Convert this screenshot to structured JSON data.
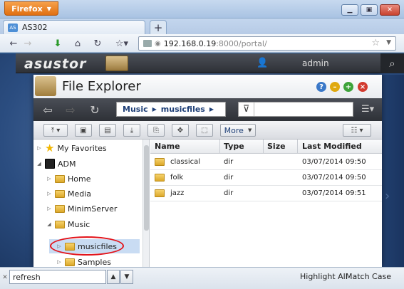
{
  "browser": {
    "app_button": "Firefox",
    "tab_title": "AS302",
    "url_host": "192.168.0.19",
    "url_rest": ":8000/portal/"
  },
  "asustor": {
    "logo": "asustor",
    "username": "admin"
  },
  "file_explorer": {
    "title": "File Explorer",
    "breadcrumb": [
      "Music",
      "musicfiles"
    ],
    "toolbar_more": "More",
    "tree": [
      {
        "label": "My Favorites"
      },
      {
        "label": "ADM"
      },
      {
        "label": "Home"
      },
      {
        "label": "Media"
      },
      {
        "label": "MinimServer"
      },
      {
        "label": "Music"
      },
      {
        "label": "musicfiles"
      },
      {
        "label": "Samples"
      }
    ],
    "columns": {
      "name": "Name",
      "type": "Type",
      "size": "Size",
      "modified": "Last Modified"
    },
    "rows": [
      {
        "name": "classical",
        "type": "dir",
        "size": "",
        "modified": "03/07/2014 09:50"
      },
      {
        "name": "folk",
        "type": "dir",
        "size": "",
        "modified": "03/07/2014 09:50"
      },
      {
        "name": "jazz",
        "type": "dir",
        "size": "",
        "modified": "03/07/2014 09:51"
      }
    ]
  },
  "findbar": {
    "value": "refresh",
    "highlight_all": "Highlight All",
    "match_case": "Match Case"
  }
}
